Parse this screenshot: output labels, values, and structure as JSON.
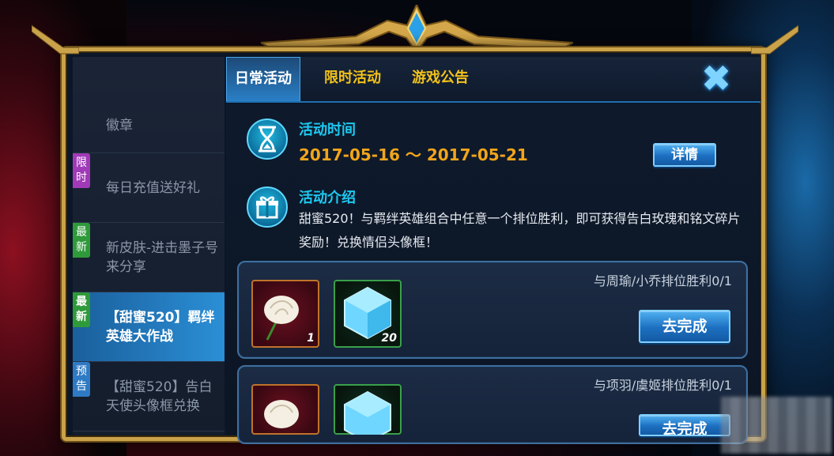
{
  "sidebar": {
    "items": [
      {
        "label": "徽章",
        "tag": ""
      },
      {
        "label": "每日充值送好礼",
        "tag": "限时"
      },
      {
        "label": "新皮肤-进击墨子号来分享",
        "tag": "最新"
      },
      {
        "label": "【甜蜜520】羁绊英雄大作战",
        "tag": "最新"
      },
      {
        "label": "【甜蜜520】告白天使头像框兑换",
        "tag": "预告"
      }
    ]
  },
  "tabs": [
    {
      "label": "日常活动"
    },
    {
      "label": "限时活动"
    },
    {
      "label": "游戏公告"
    }
  ],
  "activity": {
    "time_title": "活动时间",
    "time_range": "2017-05-16 ～ 2017-05-21",
    "details_button": "详情",
    "intro_title": "活动介绍",
    "intro_text": "甜蜜520！与羁绊英雄组合中任意一个排位胜利，即可获得告白玫瑰和铭文碎片奖励！兑换情侣头像框！"
  },
  "tasks": [
    {
      "condition": "与周瑜/小乔排位胜利0/1",
      "rose_qty": "1",
      "gem_qty": "20",
      "button": "去完成"
    },
    {
      "condition": "与项羽/虞姬排位胜利0/1",
      "rose_qty": "",
      "gem_qty": "",
      "button": "去完成"
    }
  ],
  "colors": {
    "accent_blue": "#2a7fc6",
    "gold_text": "#f2c21a",
    "time_orange": "#f2a51a",
    "title_cyan": "#1ec8f0"
  },
  "icons": {
    "close": "close-icon",
    "hourglass": "hourglass-icon",
    "gift": "gift-icon",
    "rose": "rose-icon",
    "gem": "gem-icon"
  }
}
